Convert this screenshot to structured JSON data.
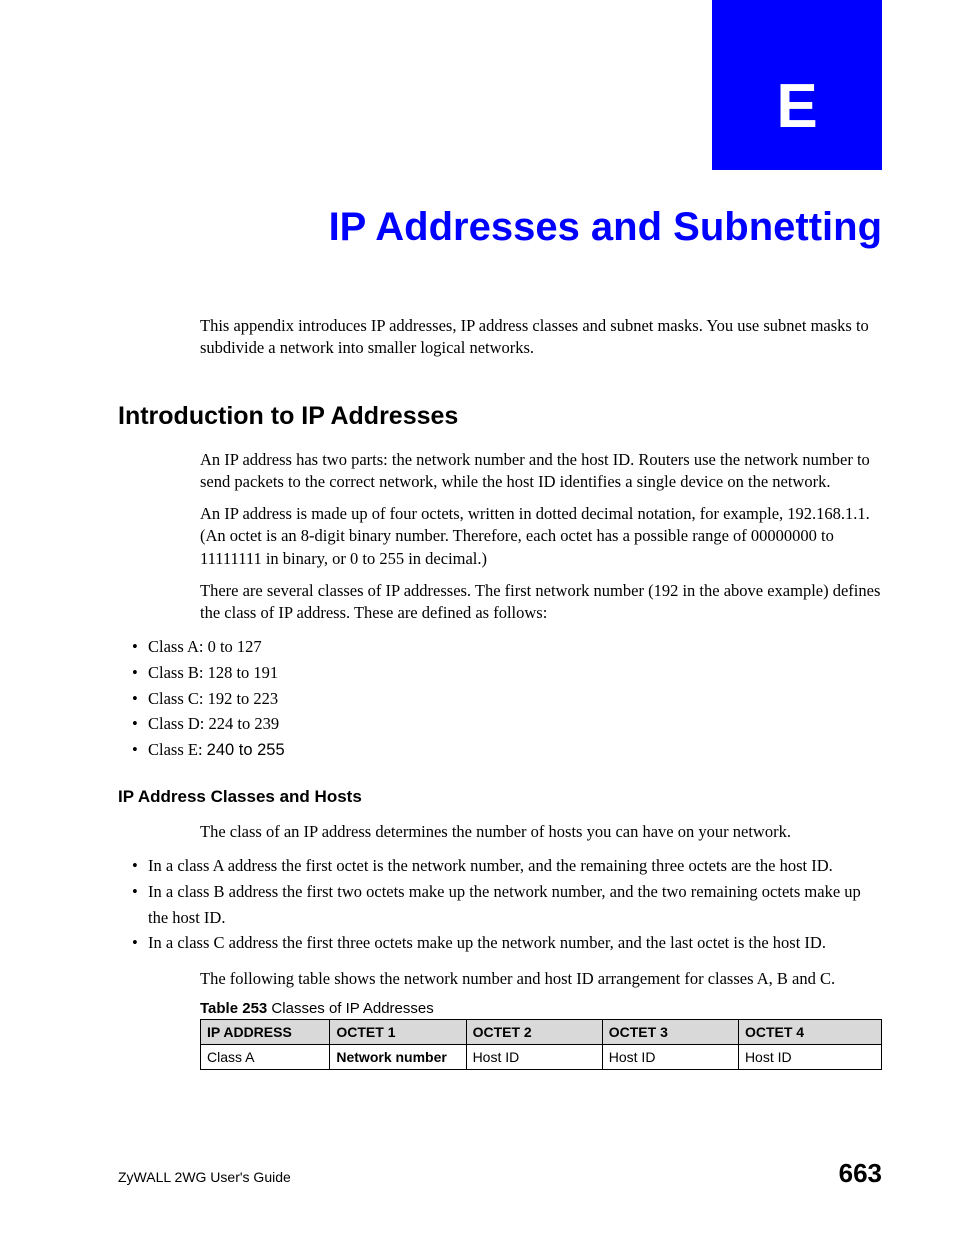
{
  "appendix": {
    "letter": "E"
  },
  "title": "IP Addresses and Subnetting",
  "intro_para": "This appendix introduces IP addresses, IP address classes and subnet masks. You use subnet masks to subdivide a network into smaller logical networks.",
  "section1": {
    "heading": "Introduction to IP Addresses",
    "p1": "An IP address has two parts: the network number and the host ID. Routers use the network number to send packets to the correct network, while the host ID identifies a single device on the network.",
    "p2": "An IP address is made up of four octets, written in dotted decimal notation, for example, 192.168.1.1. (An octet is an 8-digit binary number. Therefore, each octet has a possible range of 00000000 to 11111111 in binary, or 0 to 255 in decimal.)",
    "p3": "There are several classes of IP addresses. The first network number (192 in the above example) defines the class of IP address. These are defined as follows:",
    "classes": {
      "a_prefix": "Class A: 0 to 127",
      "b_prefix": "Class B: 128 to 191",
      "c_prefix": "Class C: 192 to 223",
      "d_prefix": "Class D: 224 to 239",
      "e_prefix": "Class E: ",
      "e_range": "240 to 255"
    }
  },
  "section2": {
    "heading": "IP Address Classes and Hosts",
    "p1": "The class of an IP address determines the number of hosts you can have on your network.",
    "bullets": {
      "b1": "In a class A address the first octet is the network number, and the remaining three octets are the host ID.",
      "b2": "In a class B address the first two octets make up the network number, and the two remaining octets make up the host ID.",
      "b3": "In a class C address the first three octets make up the network number, and the last octet is the host ID."
    },
    "p2": "The following table shows the network number and host ID arrangement for classes A, B and C."
  },
  "table": {
    "caption_label": "Table 253",
    "caption_title": "   Classes of IP Addresses",
    "headers": {
      "c1": "IP ADDRESS",
      "c2": "OCTET 1",
      "c3": "OCTET 2",
      "c4": "OCTET 3",
      "c5": "OCTET 4"
    },
    "row1": {
      "c1": "Class A",
      "c2": "Network number",
      "c3": "Host ID",
      "c4": "Host ID",
      "c5": "Host ID"
    }
  },
  "footer": {
    "guide": "ZyWALL 2WG User's Guide",
    "page": "663"
  }
}
